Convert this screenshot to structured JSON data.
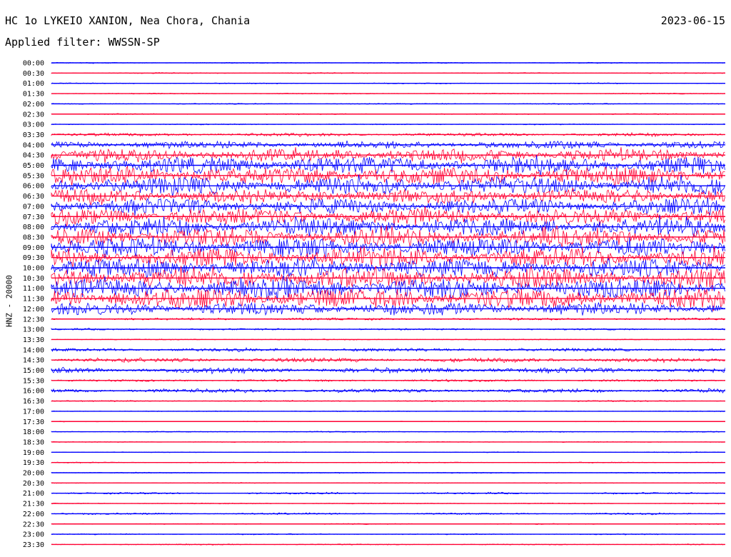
{
  "header": {
    "station": "HC 1o LYKEIO XANION, Nea Chora, Chania",
    "date": "2023-06-15",
    "filter_label": "Applied filter:",
    "filter_value": "WWSSN-SP"
  },
  "chart_data": {
    "type": "line",
    "title": "HC 1o LYKEIO XANION, Nea Chora, Chania",
    "ylabel": "HNZ - 20000",
    "series_colors": [
      "#0000ff",
      "#ff0033"
    ],
    "rows": [
      {
        "time": "00:00",
        "amplitude": 0.05
      },
      {
        "time": "00:30",
        "amplitude": 0.05
      },
      {
        "time": "01:00",
        "amplitude": 0.05
      },
      {
        "time": "01:30",
        "amplitude": 0.05
      },
      {
        "time": "02:00",
        "amplitude": 0.05
      },
      {
        "time": "02:30",
        "amplitude": 0.05
      },
      {
        "time": "03:00",
        "amplitude": 0.05
      },
      {
        "time": "03:30",
        "amplitude": 0.15
      },
      {
        "time": "04:00",
        "amplitude": 0.35
      },
      {
        "time": "04:30",
        "amplitude": 0.6
      },
      {
        "time": "05:00",
        "amplitude": 0.85
      },
      {
        "time": "05:30",
        "amplitude": 0.85
      },
      {
        "time": "06:00",
        "amplitude": 0.85
      },
      {
        "time": "06:30",
        "amplitude": 0.7
      },
      {
        "time": "07:00",
        "amplitude": 0.75
      },
      {
        "time": "07:30",
        "amplitude": 0.8
      },
      {
        "time": "08:00",
        "amplitude": 0.85
      },
      {
        "time": "08:30",
        "amplitude": 0.85
      },
      {
        "time": "09:00",
        "amplitude": 0.9
      },
      {
        "time": "09:30",
        "amplitude": 0.9
      },
      {
        "time": "10:00",
        "amplitude": 0.9
      },
      {
        "time": "10:30",
        "amplitude": 0.95
      },
      {
        "time": "11:00",
        "amplitude": 0.95
      },
      {
        "time": "11:30",
        "amplitude": 0.95
      },
      {
        "time": "12:00",
        "amplitude": 0.6
      },
      {
        "time": "12:30",
        "amplitude": 0.1
      },
      {
        "time": "13:00",
        "amplitude": 0.08
      },
      {
        "time": "13:30",
        "amplitude": 0.05
      },
      {
        "time": "14:00",
        "amplitude": 0.15
      },
      {
        "time": "14:30",
        "amplitude": 0.2
      },
      {
        "time": "15:00",
        "amplitude": 0.25
      },
      {
        "time": "15:30",
        "amplitude": 0.1
      },
      {
        "time": "16:00",
        "amplitude": 0.18
      },
      {
        "time": "16:30",
        "amplitude": 0.06
      },
      {
        "time": "17:00",
        "amplitude": 0.04
      },
      {
        "time": "17:30",
        "amplitude": 0.04
      },
      {
        "time": "18:00",
        "amplitude": 0.05
      },
      {
        "time": "18:30",
        "amplitude": 0.04
      },
      {
        "time": "19:00",
        "amplitude": 0.04
      },
      {
        "time": "19:30",
        "amplitude": 0.05
      },
      {
        "time": "20:00",
        "amplitude": 0.05
      },
      {
        "time": "20:30",
        "amplitude": 0.04
      },
      {
        "time": "21:00",
        "amplitude": 0.08
      },
      {
        "time": "21:30",
        "amplitude": 0.05
      },
      {
        "time": "22:00",
        "amplitude": 0.08
      },
      {
        "time": "22:30",
        "amplitude": 0.05
      },
      {
        "time": "23:00",
        "amplitude": 0.05
      },
      {
        "time": "23:30",
        "amplitude": 0.05
      }
    ]
  }
}
